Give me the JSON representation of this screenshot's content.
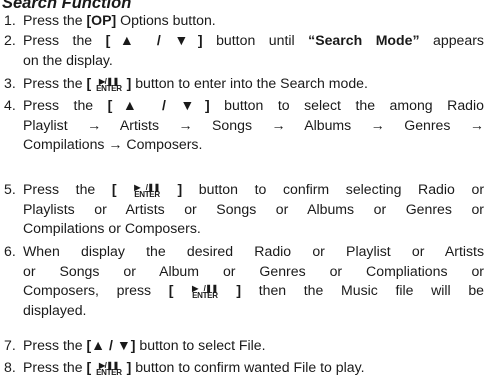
{
  "section": {
    "title": "Search Function"
  },
  "buttons": {
    "op": "[OP]",
    "updown": "[▲ / ▼]",
    "enter_glyph": "▶/❚❚",
    "enter_text": "ENTER"
  },
  "steps": [
    {
      "number": "1.",
      "lines": [
        [
          {
            "t": "Press the "
          },
          {
            "t": "[OP]",
            "b": true
          },
          {
            "t": " Options button."
          }
        ]
      ]
    },
    {
      "number": "2.",
      "lines": [
        [
          {
            "t": "Press the "
          },
          {
            "t": "[▲ / ▼]",
            "b": true
          },
          {
            "t": " button until "
          },
          {
            "t": "“Search Mode”",
            "b": true
          },
          {
            "t": " appears"
          }
        ],
        [
          {
            "t": "on the display."
          }
        ]
      ]
    },
    {
      "number": "3.",
      "lines": [
        [
          {
            "t": "Press the "
          },
          {
            "t": "[ ",
            "b": true
          },
          {
            "enter": true
          },
          {
            "t": " ]",
            "b": true
          },
          {
            "t": " button to enter into the Search mode."
          }
        ]
      ]
    },
    {
      "number": "4.",
      "lines": [
        [
          {
            "t": "Press the "
          },
          {
            "t": "[▲ / ▼]",
            "b": true
          },
          {
            "t": " button to select the among Radio"
          }
        ],
        [
          {
            "t": "Playlist → Artists → Songs → Albums → Genres →"
          }
        ],
        [
          {
            "t": "Compilations → Composers."
          }
        ]
      ]
    },
    {
      "number": "5.",
      "lines": [
        [
          {
            "t": "Press the "
          },
          {
            "t": "[ ",
            "b": true
          },
          {
            "enter": true
          },
          {
            "t": " ]",
            "b": true
          },
          {
            "t": " button to confirm selecting Radio or"
          }
        ],
        [
          {
            "t": "Playlists or Artists or Songs or Albums or Genres or"
          }
        ],
        [
          {
            "t": "Compilations or Composers."
          }
        ]
      ]
    },
    {
      "number": "6.",
      "lines": [
        [
          {
            "t": "When display the desired Radio or Playlist or Artists"
          }
        ],
        [
          {
            "t": "or Songs or Album or Genres or Compliations or"
          }
        ],
        [
          {
            "t": "Composers, press "
          },
          {
            "t": "[ ",
            "b": true
          },
          {
            "enter": true
          },
          {
            "t": " ]",
            "b": true
          },
          {
            "t": " then the Music file will be"
          }
        ],
        [
          {
            "t": "displayed."
          }
        ]
      ]
    },
    {
      "number": "7.",
      "lines": [
        [
          {
            "t": "Press the "
          },
          {
            "t": "[▲ / ▼]",
            "b": true
          },
          {
            "t": " button to select File."
          }
        ]
      ]
    },
    {
      "number": "8.",
      "lines": [
        [
          {
            "t": "Press the "
          },
          {
            "t": "[ ",
            "b": true
          },
          {
            "enter": true
          },
          {
            "t": " ]",
            "b": true
          },
          {
            "t": " button to confirm wanted File to play."
          }
        ]
      ]
    }
  ]
}
